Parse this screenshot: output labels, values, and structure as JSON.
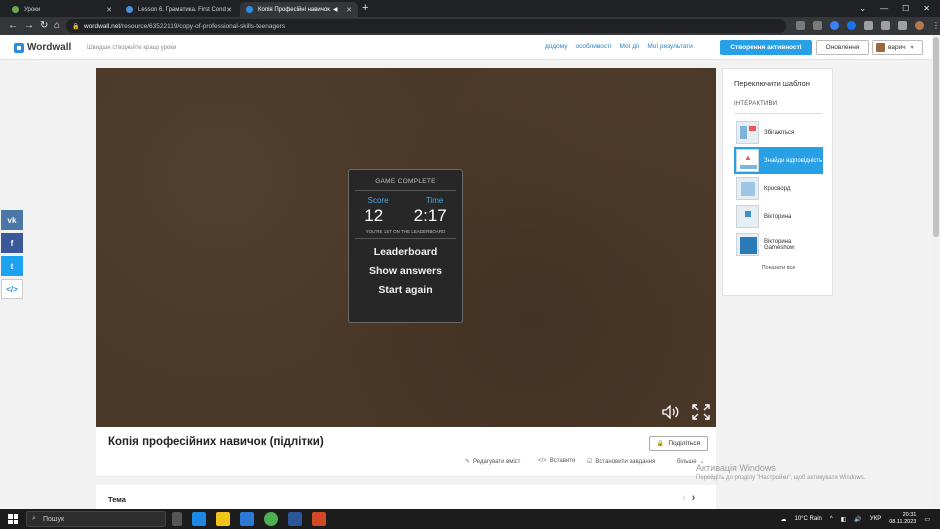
{
  "browser": {
    "tabs": [
      {
        "title": "Уроки",
        "active": false
      },
      {
        "title": "Lesson 6. Граматика. First Cond",
        "active": false
      },
      {
        "title": "Копія Професійні навичок",
        "active": true
      }
    ],
    "url_host": "wordwall.net",
    "url_path": "/resource/63522119/copy-of-professional-skills-teenagers"
  },
  "header": {
    "logo": "Wordwall",
    "tagline": "Швидше створюйте кращі уроки",
    "nav": [
      "додому",
      "особливості",
      "Мої дії",
      "Мої результати"
    ],
    "create_label": "Створення активності",
    "upgrade_label": "Оновлення",
    "user_label": "варич"
  },
  "social": [
    {
      "label": "vk",
      "color": "#4a76a8"
    },
    {
      "label": "f",
      "color": "#3b5998"
    },
    {
      "label": "t",
      "color": "#1da1f2"
    },
    {
      "label": "</>",
      "color": "#ffffff"
    }
  ],
  "game": {
    "complete_label": "GAME COMPLETE",
    "score_label": "Score",
    "time_label": "Time",
    "score": "12",
    "time": "2:17",
    "leaderboard_note": "YOU'RE 1ST ON THE LEADERBOARD",
    "options": [
      "Leaderboard",
      "Show answers",
      "Start again"
    ]
  },
  "activity": {
    "title": "Копія професійних навичок (підлітки)",
    "share_label": "Поділіться",
    "actions": [
      "Редагувати вміст",
      "Вставити",
      "Встановити завдання",
      "більше"
    ]
  },
  "theme": {
    "label": "Тема"
  },
  "sidebar": {
    "heading": "Переключити шаблон",
    "section": "ІНТЕРАКТИВИ",
    "templates": [
      {
        "label": "Збігаються",
        "selected": false
      },
      {
        "label": "Знайди відповідність",
        "selected": true
      },
      {
        "label": "Кросворд",
        "selected": false
      },
      {
        "label": "Вікторина",
        "selected": false
      },
      {
        "label": "Вікторина Gameshow",
        "selected": false
      }
    ],
    "show_all": "Показати все"
  },
  "watermark": {
    "line1": "Активація Windows",
    "line2": "Перейдіть до розділу \"Настройки\", щоб активувати Windows."
  },
  "taskbar": {
    "search": "Пошук",
    "weather": "10°C  Rain",
    "lang": "УКР",
    "time": "20:31",
    "date": "08.11.2023"
  }
}
